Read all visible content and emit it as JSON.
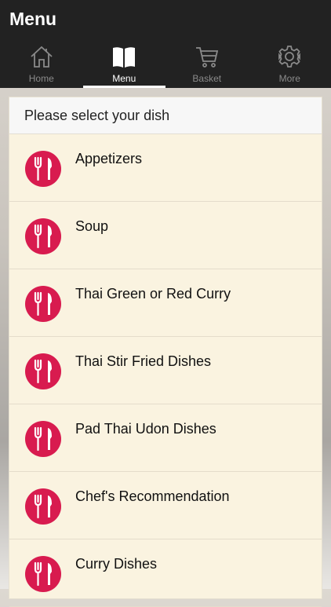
{
  "header": {
    "title": "Menu"
  },
  "tabs": [
    {
      "label": "Home",
      "icon": "home-icon",
      "active": false
    },
    {
      "label": "Menu",
      "icon": "book-icon",
      "active": true
    },
    {
      "label": "Basket",
      "icon": "cart-icon",
      "active": false
    },
    {
      "label": "More",
      "icon": "gear-icon",
      "active": false
    }
  ],
  "list": {
    "heading": "Please select your dish",
    "item_icon": "fork-knife-icon",
    "item_icon_color": "#d81b4f",
    "items": [
      "Appetizers",
      "Soup",
      "Thai Green or Red Curry",
      "Thai Stir Fried Dishes",
      "Pad Thai Udon Dishes",
      "Chef's Recommendation",
      "Curry Dishes"
    ]
  },
  "colors": {
    "header_bg": "#222222",
    "active_tab": "#ffffff",
    "inactive_tab": "#8a8a8a",
    "list_bg": "#faf3e0"
  }
}
